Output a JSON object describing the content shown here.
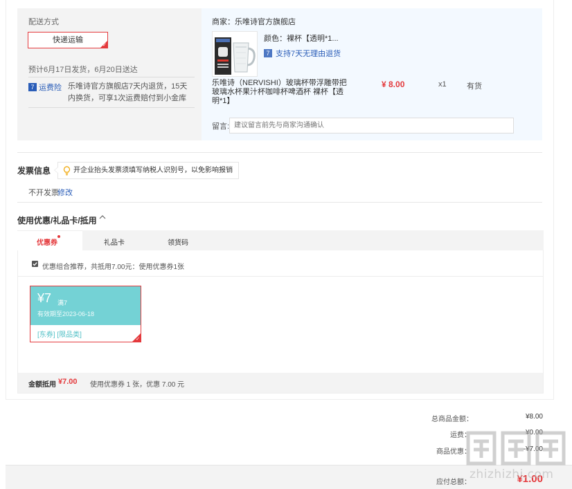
{
  "shipping": {
    "method_title": "配送方式",
    "option_label": "快递运输",
    "eta": "预计6月17日发货，6月20日送达",
    "insurance_badge": "7",
    "insurance_label": "运费险",
    "insurance_desc": "乐唯诗官方旗舰店7天内退货，15天内换货，可享1次运费赔付到小金库"
  },
  "product": {
    "shop": "商家：乐唯诗官方旗舰店",
    "color": "颜色：裸杯【透明*1...",
    "return_badge": "7",
    "return_text": "支持7天无理由退货",
    "title": "乐唯诗（NERVISHI）玻璃杯带浮雕带把玻璃水杯果汁杯咖啡杯啤酒杯 裸杯【透明*1】",
    "price": "¥ 8.00",
    "qty": "x1",
    "stock": "有货",
    "note_label": "留言:",
    "note_placeholder": "建议留言前先与商家沟通确认"
  },
  "invoice": {
    "title": "发票信息",
    "tip": "开企业抬头发票须填写纳税人识别号，以免影响报销",
    "status": "不开发票",
    "edit": "修改"
  },
  "coupons": {
    "title": "使用优惠/礼品卡/抵用",
    "tabs": [
      {
        "label": "优惠券"
      },
      {
        "label": "礼品卡"
      },
      {
        "label": "领货码"
      }
    ],
    "combo_text": "优惠组合推荐，共抵用7.00元：使用优惠券1张",
    "card": {
      "amount": "¥7",
      "condition": "满7",
      "expiry": "有效期至2023-06-18",
      "tags": "[东券] [限品类]"
    },
    "summary_label": "金额抵用",
    "summary_amount": "¥7.00",
    "summary_detail": "使用优惠券 1 张，优惠 7.00 元"
  },
  "totals": {
    "goods_label": "总商品金额：",
    "goods_value": "¥8.00",
    "shipping_label": "运费：",
    "shipping_value": "¥0.00",
    "discount_label": "商品优惠：",
    "discount_value": "-¥7.00",
    "payable_label": "应付总额：",
    "payable_value": "¥1.00"
  },
  "watermark": {
    "text": "zhizhizhi.com"
  },
  "colors": {
    "accent": "#e4393c",
    "link": "#2a5db8",
    "coupon": "#74d2d5",
    "panel_blue": "#f3f9ff",
    "panel_gray": "#f3f3f3"
  }
}
